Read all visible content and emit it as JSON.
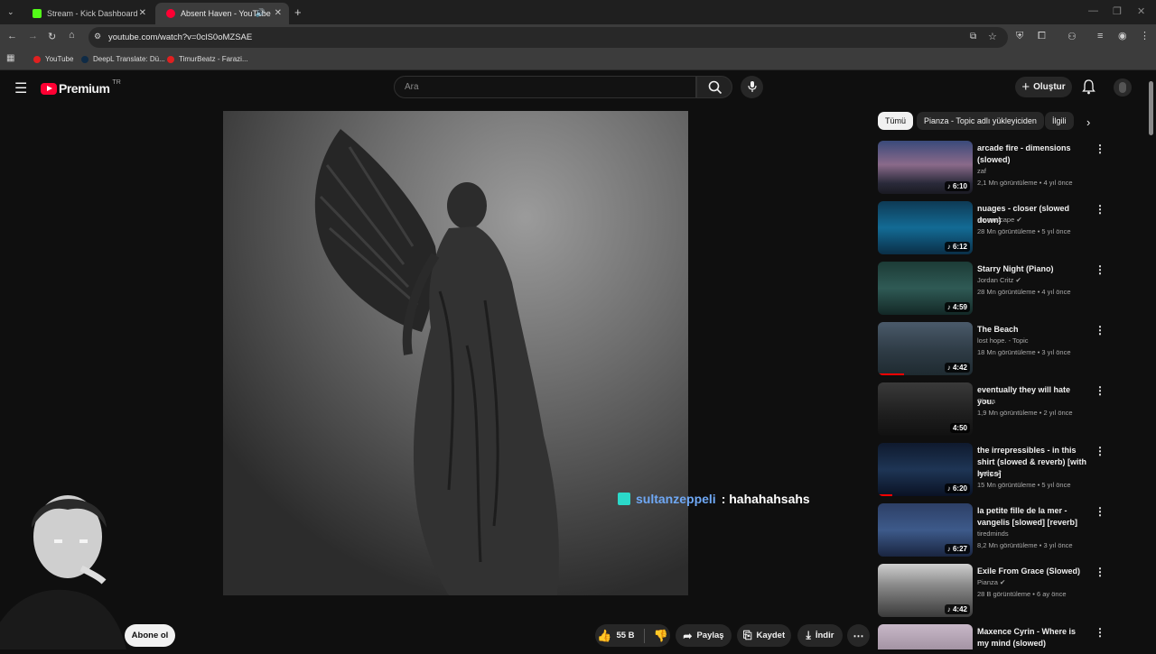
{
  "browser": {
    "tabs": [
      {
        "label": "Stream - Kick Dashboard",
        "favicon_color": "#53fc18"
      },
      {
        "label": "Absent Haven - YouTube",
        "favicon_color": "#ff0033"
      }
    ],
    "url": "youtube.com/watch?v=0clS0oMZSAE",
    "bookmarks": [
      {
        "label": "YouTube"
      },
      {
        "label": "DeepL Translate: Dü..."
      },
      {
        "label": "TimurBeatz - Farazi..."
      }
    ]
  },
  "youtube": {
    "logo_text": "Premium",
    "logo_suffix": "TR",
    "search_placeholder": "Ara",
    "create_label": "Oluştur",
    "chips": [
      "Tümü",
      "Pianza - Topic adlı yükleyiciden",
      "İlgili"
    ],
    "actions": {
      "like_count": "55 B",
      "share": "Paylaş",
      "save": "Kaydet",
      "download": "İndir"
    },
    "subscribe": "Abone ol",
    "chat": {
      "user": "sultanzeppeli",
      "message": ": hahahahsahs"
    }
  },
  "recommendations": [
    {
      "title": "arcade fire - dimensions (slowed)",
      "channel": "zaf",
      "verified": false,
      "meta": "2,1 Mn görüntüleme • 4 yıl önce",
      "duration": "6:10",
      "music": true
    },
    {
      "title": "nuages - closer (slowed down)",
      "channel": "dreamscape",
      "verified": true,
      "meta": "28 Mn görüntüleme • 5 yıl önce",
      "duration": "6:12",
      "music": true
    },
    {
      "title": "Starry Night (Piano)",
      "channel": "Jordan Critz",
      "verified": true,
      "meta": "28 Mn görüntüleme • 4 yıl önce",
      "duration": "4:59",
      "music": true
    },
    {
      "title": "The Beach",
      "channel": "lost hope. - Topic",
      "verified": false,
      "meta": "18 Mn görüntüleme • 3 yıl önce",
      "duration": "4:42",
      "music": true
    },
    {
      "title": "eventually they will hate you.",
      "channel": "Shura",
      "verified": false,
      "meta": "1,9 Mn görüntüleme • 2 yıl önce",
      "duration": "4:50",
      "music": false
    },
    {
      "title": "the irrepressibles - in this shirt (slowed & reverb) [with lyrics]",
      "channel": "lustry.",
      "verified": true,
      "meta": "15 Mn görüntüleme • 5 yıl önce",
      "duration": "6:20",
      "music": true
    },
    {
      "title": "la petite fille de la mer - vangelis [slowed] [reverb]",
      "channel": "tiredminds",
      "verified": false,
      "meta": "8,2 Mn görüntüleme • 3 yıl önce",
      "duration": "6:27",
      "music": true
    },
    {
      "title": "Exile From Grace (Slowed)",
      "channel": "Pianza",
      "verified": true,
      "meta": "28 B görüntüleme • 6 ay önce",
      "duration": "4:42",
      "music": true
    },
    {
      "title": "Maxence Cyrin - Where is my mind (slowed)",
      "channel": "",
      "verified": false,
      "meta": "",
      "duration": "",
      "music": false
    }
  ]
}
